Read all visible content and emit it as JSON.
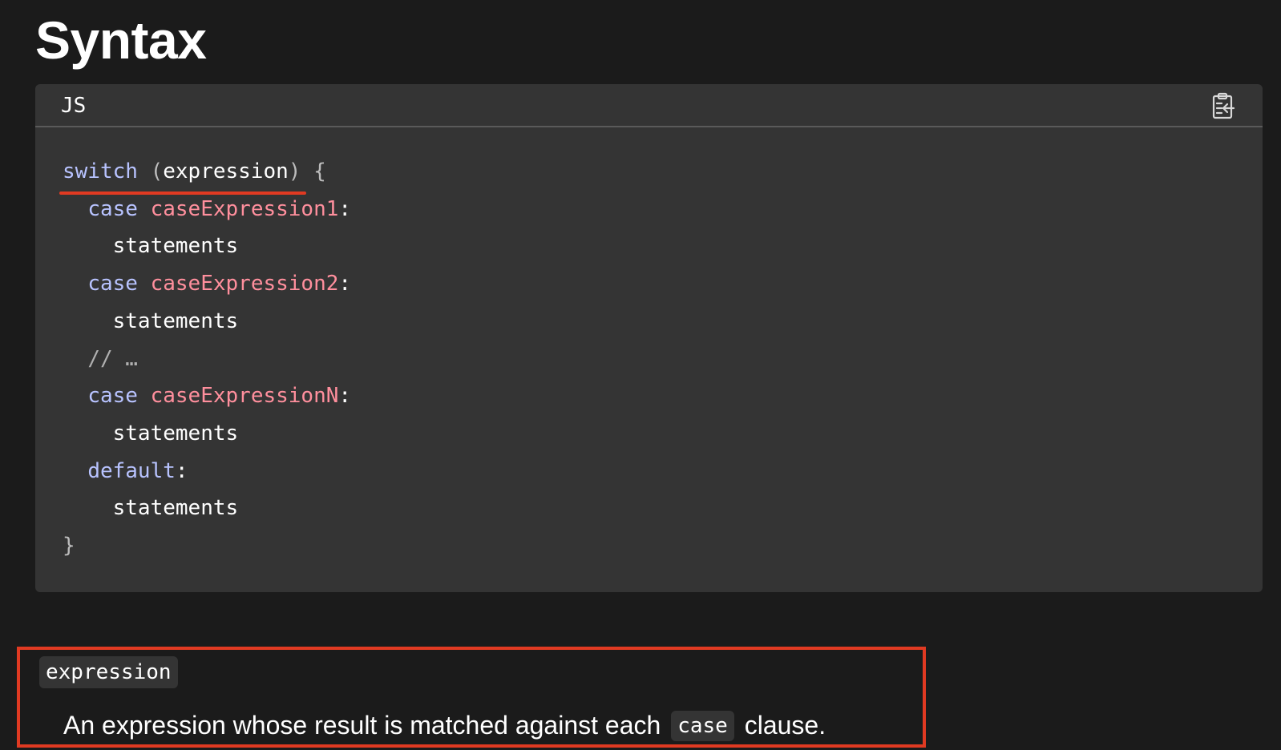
{
  "heading": "Syntax",
  "code_block": {
    "language": "JS",
    "copy_icon": "clipboard-copy-icon",
    "lines": {
      "l1_kw": "switch",
      "l1_open": " (",
      "l1_arg": "expression",
      "l1_close": ") {",
      "l2_kw": "case",
      "l2_expr": "caseExpression1",
      "l2_colon": ":",
      "l3": "statements",
      "l4_kw": "case",
      "l4_expr": "caseExpression2",
      "l4_colon": ":",
      "l5": "statements",
      "l6_comment": "// …",
      "l7_kw": "case",
      "l7_expr": "caseExpressionN",
      "l7_colon": ":",
      "l8": "statements",
      "l9_kw": "default",
      "l9_colon": ":",
      "l10": "statements",
      "l11": "}"
    }
  },
  "definition": {
    "term": "expression",
    "text_before": "An expression whose result is matched against each",
    "inline_code": "case",
    "text_after": "clause."
  },
  "colors": {
    "page_bg": "#1b1b1b",
    "code_bg": "#343434",
    "keyword": "#b8c3ff",
    "identifier": "#ff8f9d",
    "highlight": "#e13a22"
  }
}
